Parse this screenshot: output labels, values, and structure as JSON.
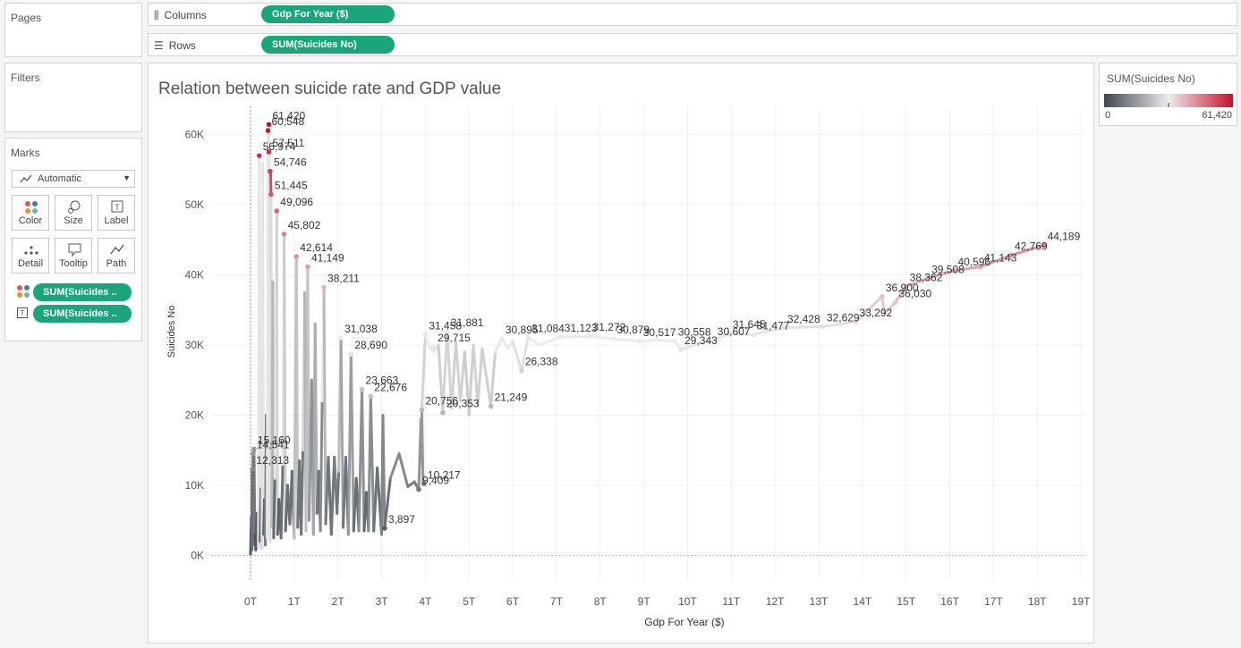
{
  "pages": {
    "title": "Pages"
  },
  "filters": {
    "title": "Filters"
  },
  "shelves": {
    "columns": {
      "label": "Columns",
      "pill": "Gdp For Year ($)"
    },
    "rows": {
      "label": "Rows",
      "pill": "SUM(Suicides No)"
    }
  },
  "marks": {
    "title": "Marks",
    "type": "Automatic",
    "buttons": [
      {
        "label": "Color",
        "icon": "color-icon"
      },
      {
        "label": "Size",
        "icon": "size-icon"
      },
      {
        "label": "Label",
        "icon": "label-icon"
      },
      {
        "label": "Detail",
        "icon": "detail-icon"
      },
      {
        "label": "Tooltip",
        "icon": "tooltip-icon"
      },
      {
        "label": "Path",
        "icon": "path-icon"
      }
    ],
    "fields": [
      {
        "text": "SUM(Suicides ..",
        "icon": "color-icon"
      },
      {
        "text": "SUM(Suicides ..",
        "icon": "label-icon"
      }
    ]
  },
  "legend": {
    "title": "SUM(Suicides No)",
    "min": "0",
    "max": "61,420",
    "color_low": "#3f474f",
    "color_mid": "#ececec",
    "color_high": "#c8102e"
  },
  "chart_data": {
    "type": "line",
    "title": "Relation between suicide rate and GDP value",
    "xlabel": "Gdp For Year ($)",
    "ylabel": "Suicides No",
    "x_unit": "trillions of $",
    "xlim": [
      -0.9,
      19.1
    ],
    "ylim": [
      -3500,
      64000
    ],
    "x_ticks": [
      "0T",
      "1T",
      "2T",
      "3T",
      "4T",
      "5T",
      "6T",
      "7T",
      "8T",
      "9T",
      "10T",
      "11T",
      "12T",
      "13T",
      "14T",
      "15T",
      "16T",
      "17T",
      "18T",
      "19T"
    ],
    "y_ticks": [
      "0K",
      "10K",
      "20K",
      "30K",
      "40K",
      "50K",
      "60K"
    ],
    "grid": true,
    "color_scale": {
      "min": 0,
      "max": 61420
    },
    "labeled_points": [
      {
        "x": 0.08,
        "y": 15160,
        "label": "15,160"
      },
      {
        "x": 0.06,
        "y": 14541,
        "label": "14,541"
      },
      {
        "x": 0.05,
        "y": 12313,
        "label": "12,313"
      },
      {
        "x": 0.2,
        "y": 56974,
        "label": "56,974"
      },
      {
        "x": 0.4,
        "y": 60548,
        "label": "60,548"
      },
      {
        "x": 0.42,
        "y": 61420,
        "label": "61,420"
      },
      {
        "x": 0.42,
        "y": 57511,
        "label": "57,511"
      },
      {
        "x": 0.45,
        "y": 54746,
        "label": "54,746"
      },
      {
        "x": 0.47,
        "y": 51445,
        "label": "51,445"
      },
      {
        "x": 0.6,
        "y": 49096,
        "label": "49,096"
      },
      {
        "x": 0.77,
        "y": 45802,
        "label": "45,802"
      },
      {
        "x": 1.05,
        "y": 42614,
        "label": "42,614"
      },
      {
        "x": 1.31,
        "y": 41149,
        "label": "41,149"
      },
      {
        "x": 1.68,
        "y": 38211,
        "label": "38,211"
      },
      {
        "x": 2.07,
        "y": 31038,
        "label": "31,038"
      },
      {
        "x": 2.3,
        "y": 28690,
        "label": "28,690"
      },
      {
        "x": 2.55,
        "y": 23663,
        "label": "23,663"
      },
      {
        "x": 2.75,
        "y": 22676,
        "label": "22,676"
      },
      {
        "x": 3.07,
        "y": 3897,
        "label": "3,897"
      },
      {
        "x": 3.85,
        "y": 9409,
        "label": "9,409"
      },
      {
        "x": 3.97,
        "y": 10217,
        "label": "10,217"
      },
      {
        "x": 3.92,
        "y": 20756,
        "label": "20,756"
      },
      {
        "x": 4.0,
        "y": 31458,
        "label": "31,458"
      },
      {
        "x": 4.2,
        "y": 29715,
        "label": "29,715"
      },
      {
        "x": 4.5,
        "y": 31881,
        "label": "31,881"
      },
      {
        "x": 4.4,
        "y": 20353,
        "label": "20,353"
      },
      {
        "x": 5.5,
        "y": 21249,
        "label": "21,249"
      },
      {
        "x": 5.75,
        "y": 30895,
        "label": "30,895"
      },
      {
        "x": 6.35,
        "y": 31084,
        "label": "31,084"
      },
      {
        "x": 6.2,
        "y": 26338,
        "label": "26,338"
      },
      {
        "x": 7.1,
        "y": 31123,
        "label": "31,123"
      },
      {
        "x": 7.75,
        "y": 31272,
        "label": "31,272"
      },
      {
        "x": 8.3,
        "y": 30879,
        "label": "30,879"
      },
      {
        "x": 8.9,
        "y": 30517,
        "label": "30,517"
      },
      {
        "x": 9.7,
        "y": 30558,
        "label": "30,558"
      },
      {
        "x": 9.85,
        "y": 29343,
        "label": "29,343"
      },
      {
        "x": 10.6,
        "y": 30607,
        "label": "30,607"
      },
      {
        "x": 10.95,
        "y": 31645,
        "label": "31,645"
      },
      {
        "x": 11.5,
        "y": 31477,
        "label": "31,477"
      },
      {
        "x": 12.2,
        "y": 32428,
        "label": "32,428"
      },
      {
        "x": 13.1,
        "y": 32629,
        "label": "32,629"
      },
      {
        "x": 13.85,
        "y": 33292,
        "label": "33,292"
      },
      {
        "x": 14.45,
        "y": 36900,
        "label": "36,900"
      },
      {
        "x": 14.75,
        "y": 36030,
        "label": "36,030"
      },
      {
        "x": 15.0,
        "y": 38362,
        "label": "38,362"
      },
      {
        "x": 15.5,
        "y": 39508,
        "label": "39,508"
      },
      {
        "x": 16.1,
        "y": 40596,
        "label": "40,596"
      },
      {
        "x": 16.7,
        "y": 41143,
        "label": "41,143"
      },
      {
        "x": 17.4,
        "y": 42769,
        "label": "42,769"
      },
      {
        "x": 18.15,
        "y": 44189,
        "label": "44,189"
      }
    ],
    "path": [
      [
        0,
        200
      ],
      [
        0.02,
        5500
      ],
      [
        0.03,
        800
      ],
      [
        0.04,
        12313
      ],
      [
        0.05,
        1500
      ],
      [
        0.06,
        14541
      ],
      [
        0.07,
        2000
      ],
      [
        0.08,
        15160
      ],
      [
        0.1,
        3000
      ],
      [
        0.12,
        800
      ],
      [
        0.15,
        6000
      ],
      [
        0.18,
        1200
      ],
      [
        0.2,
        56974
      ],
      [
        0.22,
        2000
      ],
      [
        0.24,
        9500
      ],
      [
        0.26,
        1000
      ],
      [
        0.28,
        56000
      ],
      [
        0.3,
        3000
      ],
      [
        0.32,
        8000
      ],
      [
        0.34,
        1500
      ],
      [
        0.36,
        20000
      ],
      [
        0.38,
        2500
      ],
      [
        0.4,
        60548
      ],
      [
        0.41,
        3000
      ],
      [
        0.42,
        61420
      ],
      [
        0.43,
        3500
      ],
      [
        0.44,
        57511
      ],
      [
        0.45,
        2000
      ],
      [
        0.46,
        54746
      ],
      [
        0.47,
        51445
      ],
      [
        0.49,
        4000
      ],
      [
        0.51,
        39000
      ],
      [
        0.53,
        2500
      ],
      [
        0.56,
        11000
      ],
      [
        0.6,
        49096
      ],
      [
        0.62,
        3000
      ],
      [
        0.65,
        8000
      ],
      [
        0.7,
        2500
      ],
      [
        0.74,
        13000
      ],
      [
        0.77,
        45802
      ],
      [
        0.8,
        3500
      ],
      [
        0.85,
        10000
      ],
      [
        0.9,
        4500
      ],
      [
        0.95,
        12000
      ],
      [
        1.0,
        2500
      ],
      [
        1.05,
        42614
      ],
      [
        1.08,
        4000
      ],
      [
        1.12,
        13500
      ],
      [
        1.16,
        3000
      ],
      [
        1.2,
        15000
      ],
      [
        1.24,
        37500
      ],
      [
        1.27,
        3500
      ],
      [
        1.31,
        41149
      ],
      [
        1.34,
        5000
      ],
      [
        1.4,
        25000
      ],
      [
        1.44,
        3000
      ],
      [
        1.48,
        33000
      ],
      [
        1.52,
        6000
      ],
      [
        1.56,
        12000
      ],
      [
        1.6,
        3500
      ],
      [
        1.64,
        22000
      ],
      [
        1.68,
        38211
      ],
      [
        1.72,
        4500
      ],
      [
        1.78,
        14000
      ],
      [
        1.85,
        3000
      ],
      [
        1.92,
        14000
      ],
      [
        1.98,
        6000
      ],
      [
        2.02,
        12000
      ],
      [
        2.07,
        31038
      ],
      [
        2.12,
        4000
      ],
      [
        2.18,
        14000
      ],
      [
        2.24,
        3000
      ],
      [
        2.3,
        28690
      ],
      [
        2.36,
        3500
      ],
      [
        2.42,
        11000
      ],
      [
        2.48,
        3500
      ],
      [
        2.55,
        23663
      ],
      [
        2.6,
        3500
      ],
      [
        2.65,
        9000
      ],
      [
        2.7,
        3500
      ],
      [
        2.75,
        22676
      ],
      [
        2.82,
        3500
      ],
      [
        2.9,
        12500
      ],
      [
        3.0,
        3000
      ],
      [
        3.03,
        20000
      ],
      [
        3.07,
        3897
      ],
      [
        3.2,
        11000
      ],
      [
        3.4,
        14500
      ],
      [
        3.6,
        9800
      ],
      [
        3.75,
        10500
      ],
      [
        3.85,
        9409
      ],
      [
        3.9,
        19500
      ],
      [
        3.95,
        10217
      ],
      [
        3.92,
        20756
      ],
      [
        4.0,
        31458
      ],
      [
        4.1,
        29715
      ],
      [
        4.2,
        29000
      ],
      [
        4.3,
        30000
      ],
      [
        4.4,
        20353
      ],
      [
        4.5,
        31881
      ],
      [
        4.6,
        21000
      ],
      [
        4.7,
        30500
      ],
      [
        4.8,
        22000
      ],
      [
        4.9,
        29000
      ],
      [
        5.0,
        20000
      ],
      [
        5.1,
        30000
      ],
      [
        5.2,
        21500
      ],
      [
        5.3,
        29500
      ],
      [
        5.5,
        21249
      ],
      [
        5.6,
        29000
      ],
      [
        5.75,
        30895
      ],
      [
        5.9,
        29500
      ],
      [
        6.0,
        30500
      ],
      [
        6.2,
        26338
      ],
      [
        6.35,
        31084
      ],
      [
        6.6,
        30000
      ],
      [
        7.1,
        31123
      ],
      [
        7.75,
        31272
      ],
      [
        8.3,
        30879
      ],
      [
        8.9,
        30517
      ],
      [
        9.3,
        30700
      ],
      [
        9.7,
        30558
      ],
      [
        9.85,
        29343
      ],
      [
        10.2,
        30100
      ],
      [
        10.6,
        30607
      ],
      [
        10.95,
        31645
      ],
      [
        11.5,
        31477
      ],
      [
        12.2,
        32428
      ],
      [
        13.1,
        32629
      ],
      [
        13.85,
        33292
      ],
      [
        14.45,
        36900
      ],
      [
        14.5,
        34500
      ],
      [
        14.75,
        36030
      ],
      [
        15.0,
        38362
      ],
      [
        15.5,
        39508
      ],
      [
        16.1,
        40596
      ],
      [
        16.7,
        41143
      ],
      [
        17.4,
        42769
      ],
      [
        18.15,
        44189
      ]
    ]
  }
}
